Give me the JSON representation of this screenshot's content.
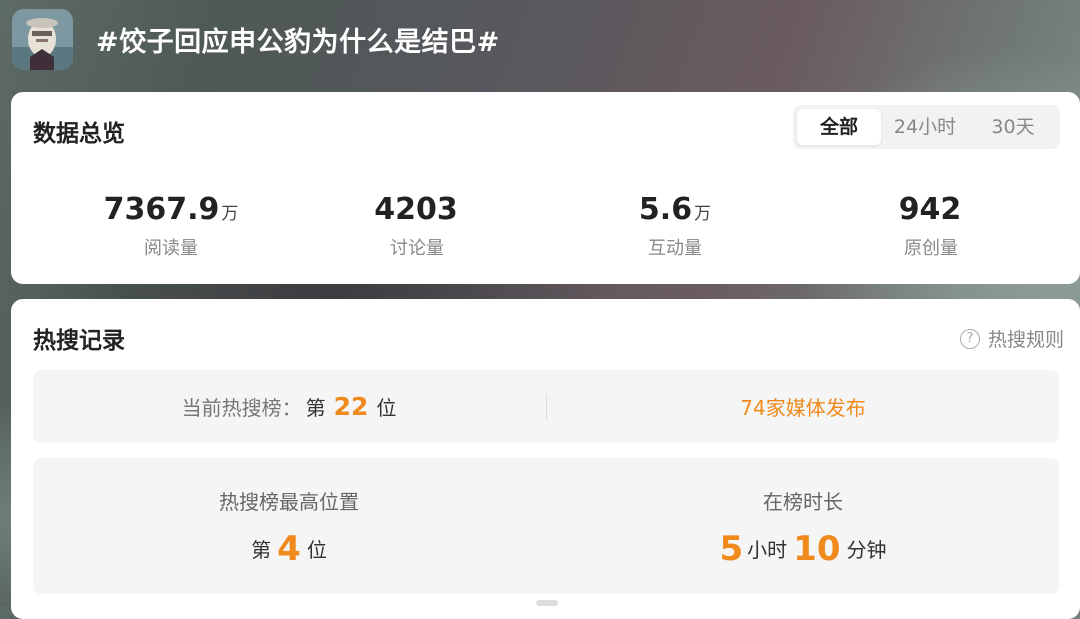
{
  "header": {
    "topic_title": "#饺子回应申公豹为什么是结巴#"
  },
  "overview": {
    "title": "数据总览",
    "tabs": [
      "全部",
      "24小时",
      "30天"
    ],
    "selected_tab": "全部",
    "stats": [
      {
        "value": "7367.9",
        "unit": "万",
        "label": "阅读量"
      },
      {
        "value": "4203",
        "unit": "",
        "label": "讨论量"
      },
      {
        "value": "5.6",
        "unit": "万",
        "label": "互动量"
      },
      {
        "value": "942",
        "unit": "",
        "label": "原创量"
      }
    ]
  },
  "hot_search": {
    "title": "热搜记录",
    "rules_label": "热搜规则",
    "current_rank_label": "当前热搜榜：",
    "current_rank_prefix": "第",
    "current_rank_value": "22",
    "current_rank_suffix": "位",
    "media_link": "74家媒体发布",
    "highest_title": "热搜榜最高位置",
    "highest_prefix": "第",
    "highest_value": "4",
    "highest_suffix": "位",
    "duration_title": "在榜时长",
    "duration_hours": "5",
    "duration_hours_unit": "小时",
    "duration_minutes": "10",
    "duration_minutes_unit": "分钟"
  },
  "colors": {
    "accent": "#f08a1d",
    "card_bg": "#ffffff",
    "panel_bg": "#f5f5f5"
  },
  "icons": {
    "help": "question-circle-icon"
  }
}
